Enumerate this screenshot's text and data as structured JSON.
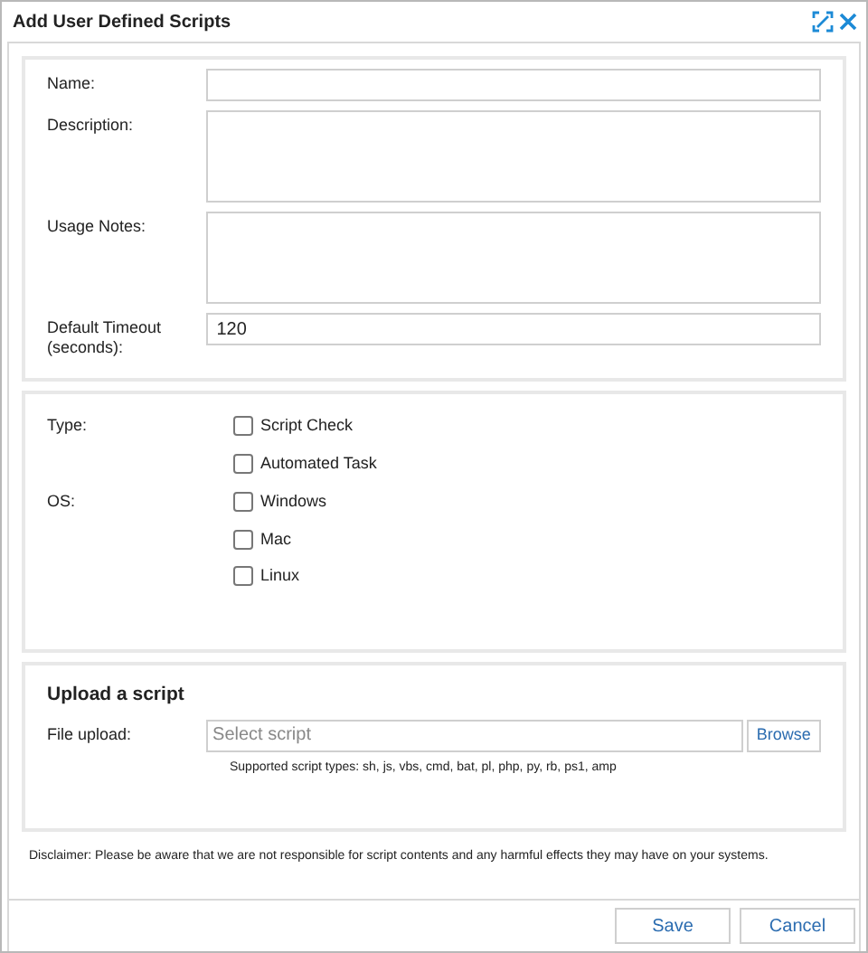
{
  "window": {
    "title": "Add User Defined Scripts"
  },
  "details": {
    "fields": [
      {
        "label": "Name:",
        "kind": "line"
      },
      {
        "label": "Description:",
        "kind": "area"
      },
      {
        "label": "Usage Notes:",
        "kind": "area"
      },
      {
        "label": "Default Timeout (seconds):",
        "kind": "line",
        "value": "120"
      }
    ]
  },
  "options": {
    "groups": [
      {
        "label": "Type:",
        "items": [
          {
            "label": "Script Check",
            "checked": false
          },
          {
            "label": "Automated Task",
            "checked": false
          }
        ]
      },
      {
        "label": "OS:",
        "items": [
          {
            "label": "Windows",
            "checked": false
          },
          {
            "label": "Mac",
            "checked": false
          },
          {
            "label": "Linux",
            "checked": false
          }
        ]
      }
    ]
  },
  "upload": {
    "heading": "Upload a script",
    "label": "File upload:",
    "placeholder": "Select script",
    "browse_button": "Browse",
    "hint": "Supported script types: sh, js, vbs, cmd, bat, pl, php, py, rb, ps1, amp"
  },
  "disclaimer": "Disclaimer: Please be aware that we are not responsible for script contents and any harmful effects they may have on your systems.",
  "buttons": [
    "Save",
    "Cancel"
  ]
}
